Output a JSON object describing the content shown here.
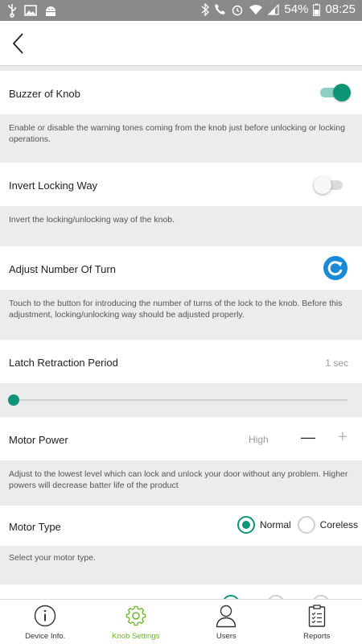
{
  "status_bar": {
    "battery": "54%",
    "time": "08:25"
  },
  "colors": {
    "accent": "#0f9478",
    "active_tab": "#6bb526",
    "desc_bg": "#ececec"
  },
  "header": {
    "back_icon": "back-chevron-icon"
  },
  "settings": {
    "buzzer": {
      "label": "Buzzer of Knob",
      "enabled": true,
      "description": "Enable or disable the warning tones coming from the knob just before unlocking or locking operations."
    },
    "invert": {
      "label": "Invert Locking Way",
      "enabled": false,
      "description": "Invert the locking/unlocking way of the knob."
    },
    "adjust": {
      "label": "Adjust Number Of Turn",
      "icon": "refresh-icon",
      "description": "Touch to the button for introducing the number of turns of the lock to the knob. Before this adjustment, locking/unlocking way should be adjusted properly."
    },
    "latch": {
      "label": "Latch Retraction Period",
      "value": "1 sec",
      "slider_fraction": 0
    },
    "motor_power": {
      "label": "Motor Power",
      "value": "High",
      "minus": "—",
      "plus": "+",
      "description": "Adjust to the lowest level which can lock and unlock your door without any problem. Higher powers will decrease batter life of the product"
    },
    "motor_type": {
      "label": "Motor Type",
      "options": [
        "Normal",
        "Coreless"
      ],
      "selected": "Normal",
      "description": "Select your motor type."
    }
  },
  "bottom_nav": {
    "tabs": [
      {
        "label": "Device Info.",
        "icon": "info-icon"
      },
      {
        "label": "Knob Settings",
        "icon": "gear-icon",
        "active": true
      },
      {
        "label": "Users",
        "icon": "user-icon"
      },
      {
        "label": "Reports",
        "icon": "clipboard-icon"
      }
    ]
  }
}
